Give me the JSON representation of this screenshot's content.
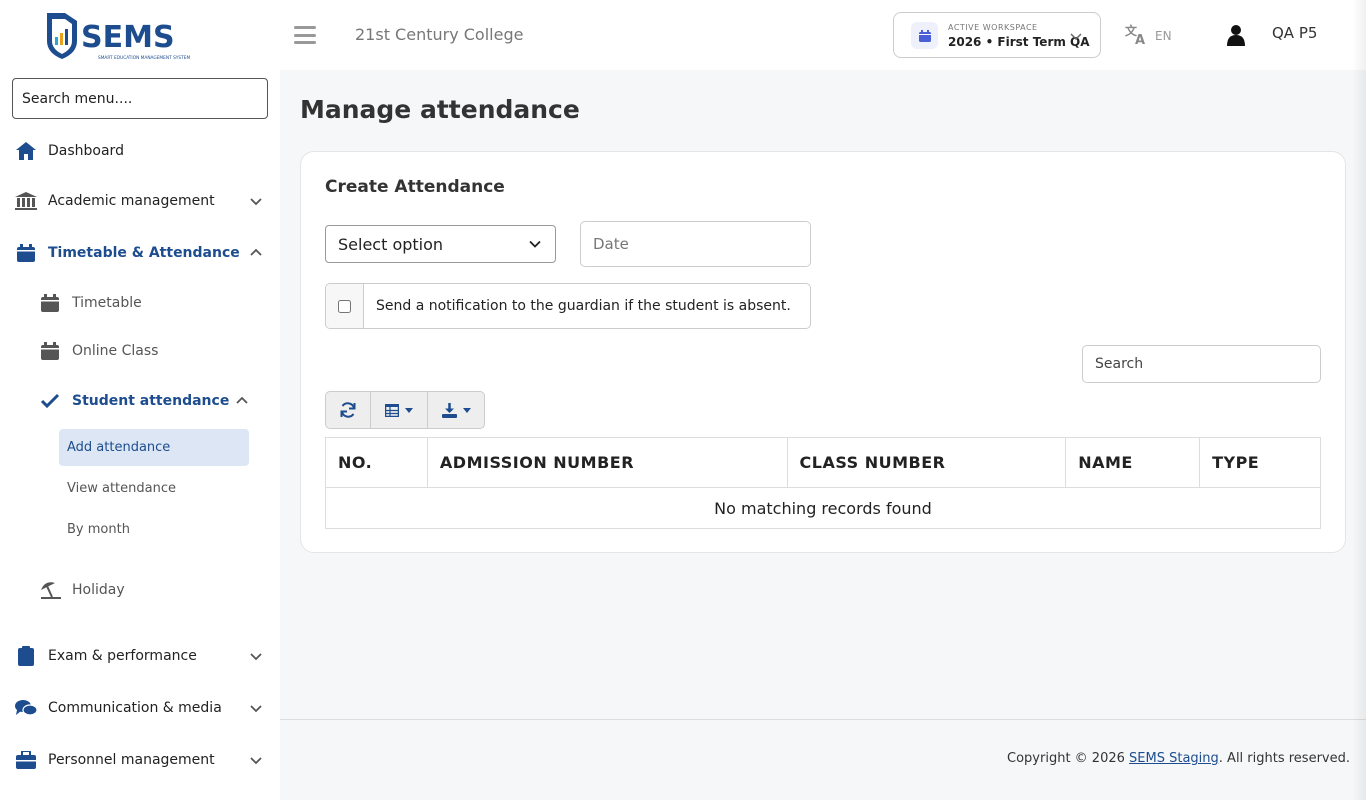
{
  "brand": {
    "name": "SEMS",
    "tagline": "SMART EDUCATION MANAGEMENT SYSTEM"
  },
  "sidebar": {
    "search_placeholder": "Search menu....",
    "items": [
      {
        "label": "Dashboard",
        "icon": "home-icon"
      },
      {
        "label": "Academic management",
        "icon": "bank-icon"
      },
      {
        "label": "Timetable & Attendance",
        "icon": "calendar-icon"
      },
      {
        "label": "Timetable",
        "icon": "calendar-icon"
      },
      {
        "label": "Online Class",
        "icon": "calendar-icon"
      },
      {
        "label": "Student attendance",
        "icon": "check-icon"
      },
      {
        "label": "Add attendance"
      },
      {
        "label": "View attendance"
      },
      {
        "label": "By month"
      },
      {
        "label": "Holiday",
        "icon": "umbrella-beach-icon"
      },
      {
        "label": "Exam & performance",
        "icon": "clipboard-icon"
      },
      {
        "label": "Communication & media",
        "icon": "comments-icon"
      },
      {
        "label": "Personnel management",
        "icon": "briefcase-icon"
      }
    ]
  },
  "header": {
    "college": "21st Century College",
    "workspace_caption": "ACTIVE WORKSPACE",
    "workspace_value": "2026 • First Term QA",
    "language": "EN",
    "user": "QA P5"
  },
  "main": {
    "title": "Manage attendance",
    "card_title": "Create Attendance",
    "select_value": "Select option",
    "date_placeholder": "Date",
    "notify_text": "Send a notification to the guardian if the student is absent.",
    "search_placeholder": "Search",
    "table": {
      "columns": [
        "NO.",
        "ADMISSION NUMBER",
        "CLASS NUMBER",
        "NAME",
        "TYPE"
      ],
      "empty": "No matching records found"
    }
  },
  "footer": {
    "prefix": "Copyright © 2026 ",
    "link": "SEMS Staging",
    "suffix": ". All rights reserved."
  },
  "colors": {
    "accent": "#1d4d8f",
    "active_bg": "#dce6f5"
  }
}
